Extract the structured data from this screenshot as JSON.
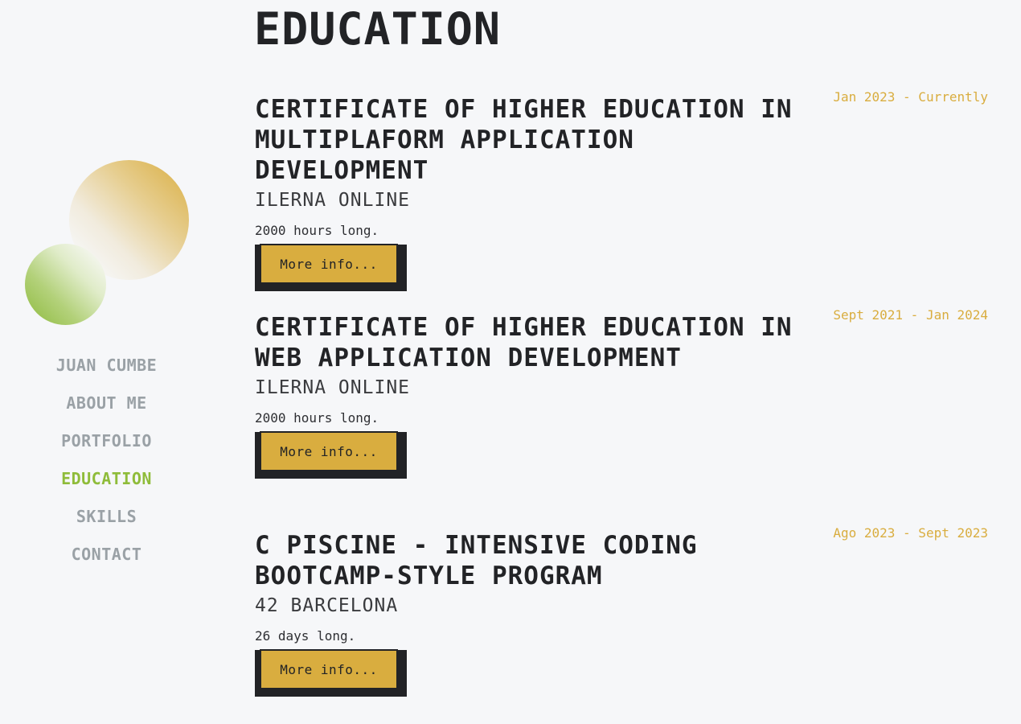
{
  "nav": {
    "items": [
      {
        "label": "JUAN CUMBE"
      },
      {
        "label": "ABOUT ME"
      },
      {
        "label": "PORTFOLIO"
      },
      {
        "label": "EDUCATION"
      },
      {
        "label": "SKILLS"
      },
      {
        "label": "CONTACT"
      }
    ],
    "active": "EDUCATION"
  },
  "page": {
    "title": "EDUCATION"
  },
  "entries": [
    {
      "title": "CERTIFICATE OF HIGHER EDUCATION IN MULTIPLAFORM APPLICATION DEVELOPMENT",
      "school": "ILERNA ONLINE",
      "duration": "2000 hours long.",
      "date": "Jan 2023 - Currently",
      "button": "More info..."
    },
    {
      "title": "CERTIFICATE OF HIGHER EDUCATION IN WEB APPLICATION DEVELOPMENT",
      "school": "ILERNA ONLINE",
      "duration": "2000 hours long.",
      "date": "Sept 2021 - Jan 2024",
      "button": "More info..."
    },
    {
      "title": "C PISCINE - INTENSIVE CODING BOOTCAMP-STYLE PROGRAM",
      "school": "42 BARCELONA",
      "duration": "26 days long.",
      "date": "Ago 2023 - Sept 2023",
      "button": "More info..."
    }
  ],
  "colors": {
    "accent_gold": "#d9ad3f",
    "accent_green": "#8fbc3a",
    "nav_inactive": "#9aa1a6",
    "text_dark": "#222326",
    "background": "#f6f7f9"
  }
}
